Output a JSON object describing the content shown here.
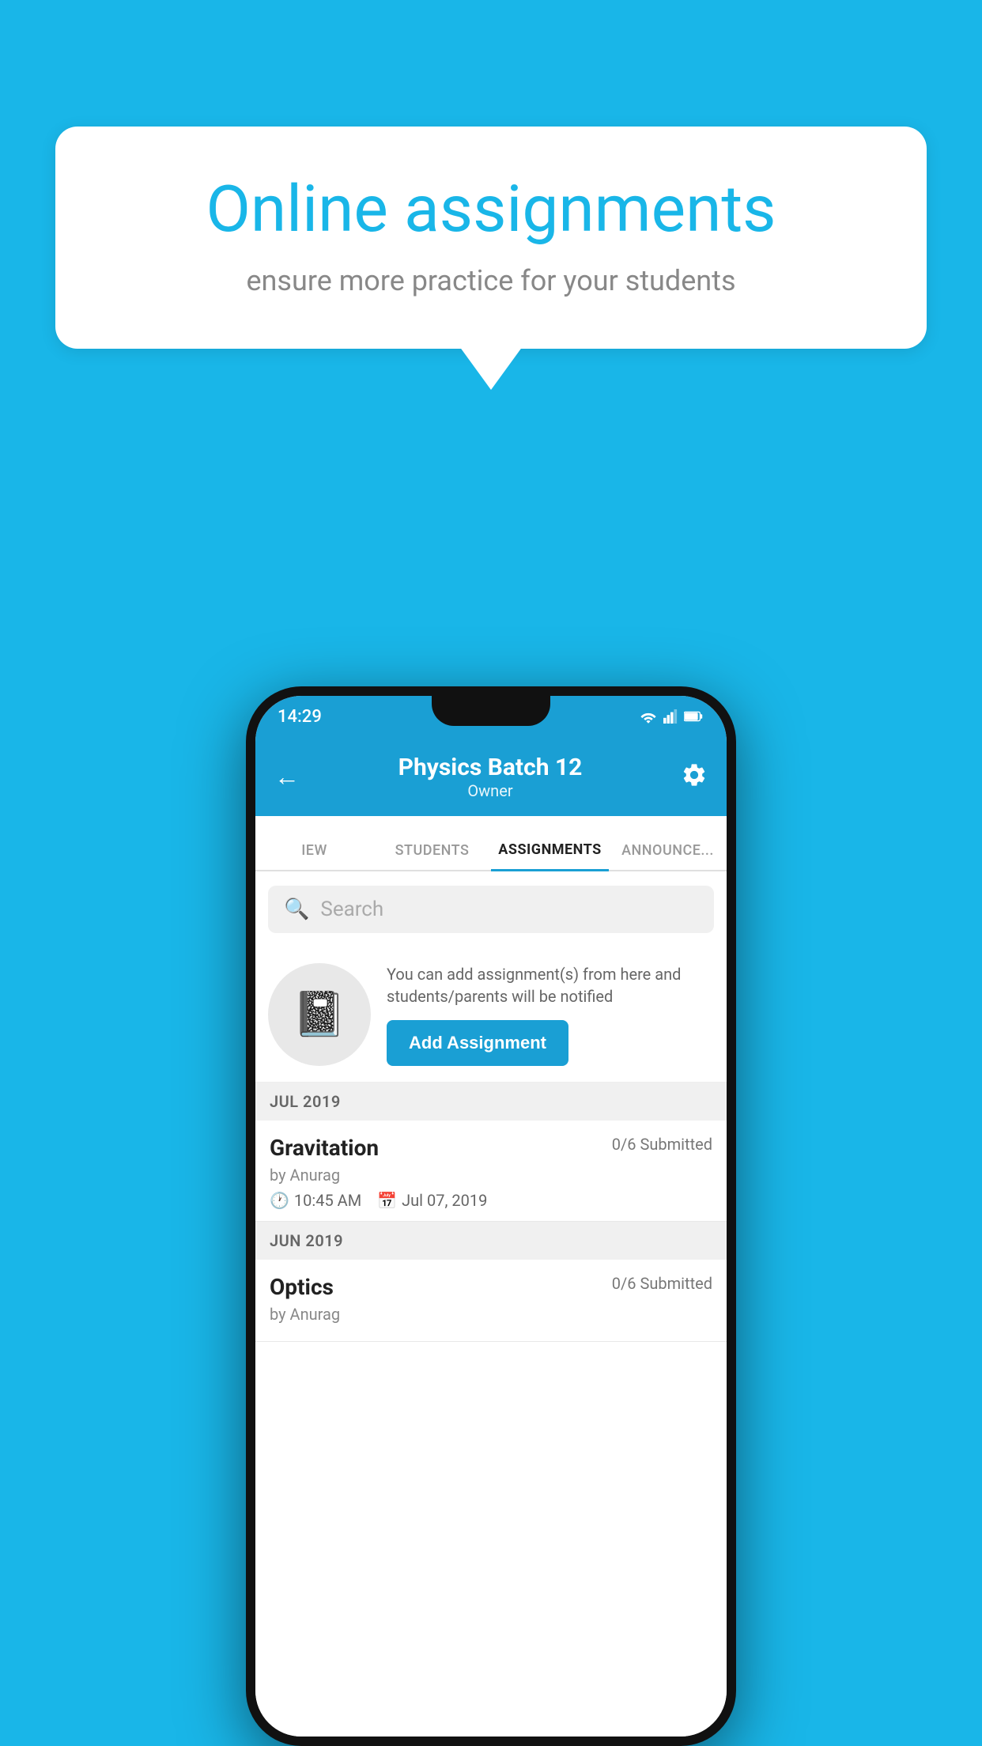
{
  "background_color": "#19b6e8",
  "speech_bubble": {
    "title": "Online assignments",
    "subtitle": "ensure more practice for your students"
  },
  "phone": {
    "status_bar": {
      "time": "14:29",
      "icons": [
        "wifi",
        "signal",
        "battery"
      ]
    },
    "header": {
      "title": "Physics Batch 12",
      "subtitle": "Owner",
      "back_label": "←",
      "settings_label": "⚙"
    },
    "tabs": [
      {
        "label": "IEW",
        "active": false
      },
      {
        "label": "STUDENTS",
        "active": false
      },
      {
        "label": "ASSIGNMENTS",
        "active": true
      },
      {
        "label": "ANNOUNCEMENTS",
        "active": false
      }
    ],
    "search": {
      "placeholder": "Search"
    },
    "promo": {
      "description": "You can add assignment(s) from here and students/parents will be notified",
      "button_label": "Add Assignment"
    },
    "sections": [
      {
        "month": "JUL 2019",
        "assignments": [
          {
            "name": "Gravitation",
            "submitted": "0/6 Submitted",
            "by": "by Anurag",
            "time": "10:45 AM",
            "date": "Jul 07, 2019"
          }
        ]
      },
      {
        "month": "JUN 2019",
        "assignments": [
          {
            "name": "Optics",
            "submitted": "0/6 Submitted",
            "by": "by Anurag",
            "time": "",
            "date": ""
          }
        ]
      }
    ]
  }
}
